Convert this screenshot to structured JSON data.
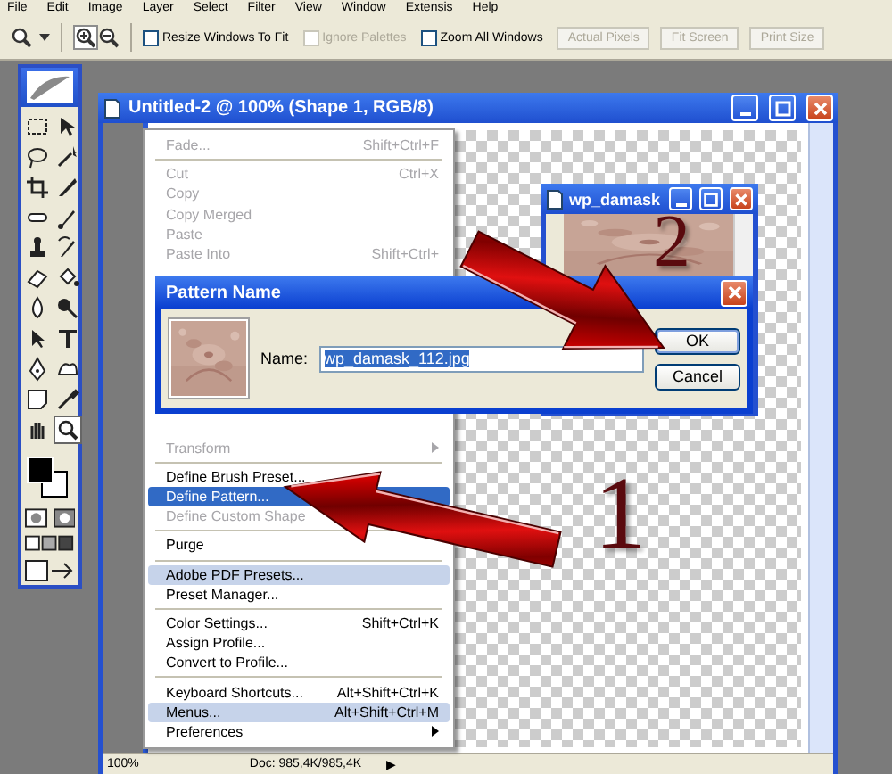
{
  "menu_bar": {
    "items": [
      "File",
      "Edit",
      "Image",
      "Layer",
      "Select",
      "Filter",
      "View",
      "Window",
      "Extensis",
      "Help"
    ]
  },
  "options_bar": {
    "checkboxes": [
      {
        "label": "Resize Windows To Fit",
        "checked": false,
        "disabled": false
      },
      {
        "label": "Ignore Palettes",
        "checked": false,
        "disabled": true
      },
      {
        "label": "Zoom All Windows",
        "checked": false,
        "disabled": false
      }
    ],
    "buttons": [
      {
        "label": "Actual Pixels",
        "disabled": true
      },
      {
        "label": "Fit Screen",
        "disabled": true
      },
      {
        "label": "Print Size",
        "disabled": true
      }
    ]
  },
  "document_window": {
    "title": "Untitled-2 @ 100% (Shape 1, RGB/8)",
    "status_zoom": "100%",
    "status_doc": "Doc: 985,4K/985,4K",
    "status_arrow": "▶"
  },
  "edit_menu": {
    "top_items": [
      {
        "kind": "item",
        "label": "Fade...",
        "shortcut": "Shift+Ctrl+F",
        "disabled": true,
        "selected": false,
        "highlighted": false,
        "submenu": false
      },
      {
        "kind": "separator"
      },
      {
        "kind": "item",
        "label": "Cut",
        "shortcut": "Ctrl+X",
        "disabled": true,
        "selected": false,
        "highlighted": false,
        "submenu": false
      },
      {
        "kind": "item",
        "label": "Copy",
        "disabled": true,
        "selected": false,
        "highlighted": false,
        "submenu": false
      },
      {
        "kind": "item",
        "label": "Copy Merged",
        "disabled": true,
        "selected": false,
        "highlighted": false,
        "submenu": false
      },
      {
        "kind": "item",
        "label": "Paste",
        "disabled": true,
        "selected": false,
        "highlighted": false,
        "submenu": false
      },
      {
        "kind": "item",
        "label": "Paste Into",
        "shortcut": "Shift+Ctrl+",
        "disabled": true,
        "selected": false,
        "highlighted": false,
        "submenu": false
      }
    ],
    "bottom_items": [
      {
        "kind": "item",
        "label": "Transform",
        "disabled": true,
        "selected": false,
        "highlighted": false,
        "submenu": true
      },
      {
        "kind": "separator"
      },
      {
        "kind": "item",
        "label": "Define Brush Preset...",
        "disabled": false,
        "selected": false,
        "highlighted": false,
        "submenu": false
      },
      {
        "kind": "item",
        "label": "Define Pattern...",
        "disabled": false,
        "selected": true,
        "highlighted": false,
        "submenu": false
      },
      {
        "kind": "item",
        "label": "Define Custom Shape",
        "disabled": true,
        "selected": false,
        "highlighted": false,
        "submenu": false
      },
      {
        "kind": "separator"
      },
      {
        "kind": "item",
        "label": "Purge",
        "disabled": false,
        "selected": false,
        "highlighted": false,
        "submenu": false
      },
      {
        "kind": "separator"
      },
      {
        "kind": "item",
        "label": "Adobe PDF Presets...",
        "disabled": false,
        "selected": false,
        "highlighted": true,
        "submenu": false
      },
      {
        "kind": "item",
        "label": "Preset Manager...",
        "disabled": false,
        "selected": false,
        "highlighted": false,
        "submenu": false
      },
      {
        "kind": "separator"
      },
      {
        "kind": "item",
        "label": "Color Settings...",
        "shortcut": "Shift+Ctrl+K",
        "disabled": false,
        "selected": false,
        "highlighted": false,
        "submenu": false
      },
      {
        "kind": "item",
        "label": "Assign Profile...",
        "disabled": false,
        "selected": false,
        "highlighted": false,
        "submenu": false
      },
      {
        "kind": "item",
        "label": "Convert to Profile...",
        "disabled": false,
        "selected": false,
        "highlighted": false,
        "submenu": false
      },
      {
        "kind": "separator"
      },
      {
        "kind": "item",
        "label": "Keyboard Shortcuts...",
        "shortcut": "Alt+Shift+Ctrl+K",
        "disabled": false,
        "selected": false,
        "highlighted": false,
        "submenu": false
      },
      {
        "kind": "item",
        "label": "Menus...",
        "shortcut": "Alt+Shift+Ctrl+M",
        "disabled": false,
        "selected": false,
        "highlighted": true,
        "submenu": false
      },
      {
        "kind": "item",
        "label": "Preferences",
        "disabled": false,
        "selected": false,
        "highlighted": false,
        "submenu": true
      }
    ]
  },
  "second_window": {
    "title": "wp_damask"
  },
  "dialog": {
    "title": "Pattern Name",
    "name_label": "Name:",
    "name_value": "wp_damask_112.jpg",
    "value_selected": true,
    "buttons": [
      {
        "label": "OK",
        "default": true
      },
      {
        "label": "Cancel",
        "default": false
      }
    ]
  },
  "annotations": [
    {
      "label": "1"
    },
    {
      "label": "2"
    }
  ]
}
